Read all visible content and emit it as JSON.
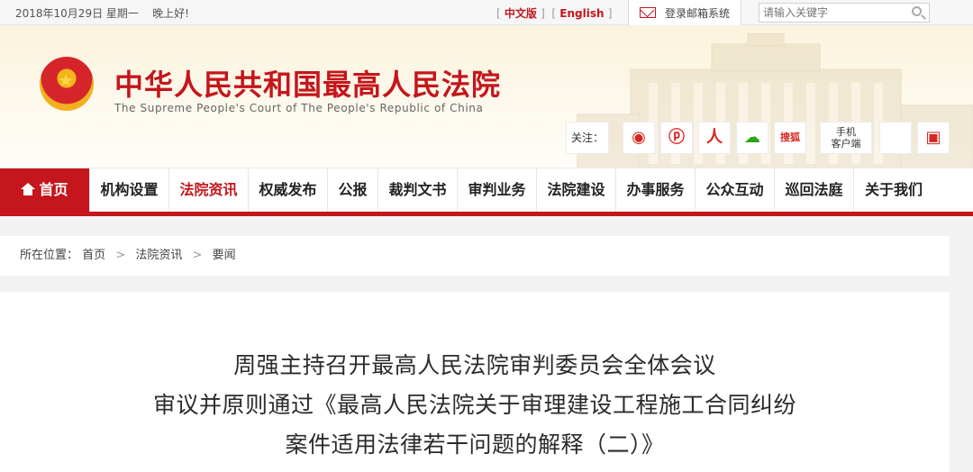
{
  "topbar": {
    "date": "2018年10月29日 星期一",
    "greeting": "晚上好!",
    "lang_cn": "中文版",
    "lang_en": "English",
    "mail": "登录邮箱系统",
    "search_placeholder": "请输入关键字"
  },
  "header": {
    "title": "中华人民共和国最高人民法院",
    "subtitle": "The Supreme People's Court of The People's Republic of China",
    "follow": "关注：",
    "social": [
      "weibo-icon",
      "tencent-weibo-icon",
      "people-icon",
      "wechat-icon",
      "sohu-icon"
    ],
    "sohu_label": "搜狐",
    "mobile_label_1": "手机",
    "mobile_label_2": "客户端"
  },
  "nav": {
    "items": [
      "首页",
      "机构设置",
      "法院资讯",
      "权威发布",
      "公报",
      "裁判文书",
      "审判业务",
      "法院建设",
      "办事服务",
      "公众互动",
      "巡回法庭",
      "关于我们"
    ],
    "active_index": 2
  },
  "breadcrumb": {
    "label": "所在位置：",
    "path": [
      "首页",
      "法院资讯",
      "要闻"
    ]
  },
  "article": {
    "title_lines": [
      "周强主持召开最高人民法院审判委员会全体会议",
      "审议并原则通过《最高人民法院关于审理建设工程施工合同纠纷",
      "案件适用法律若干问题的解释（二）》"
    ]
  },
  "colors": {
    "brand_red": "#c4161c"
  }
}
